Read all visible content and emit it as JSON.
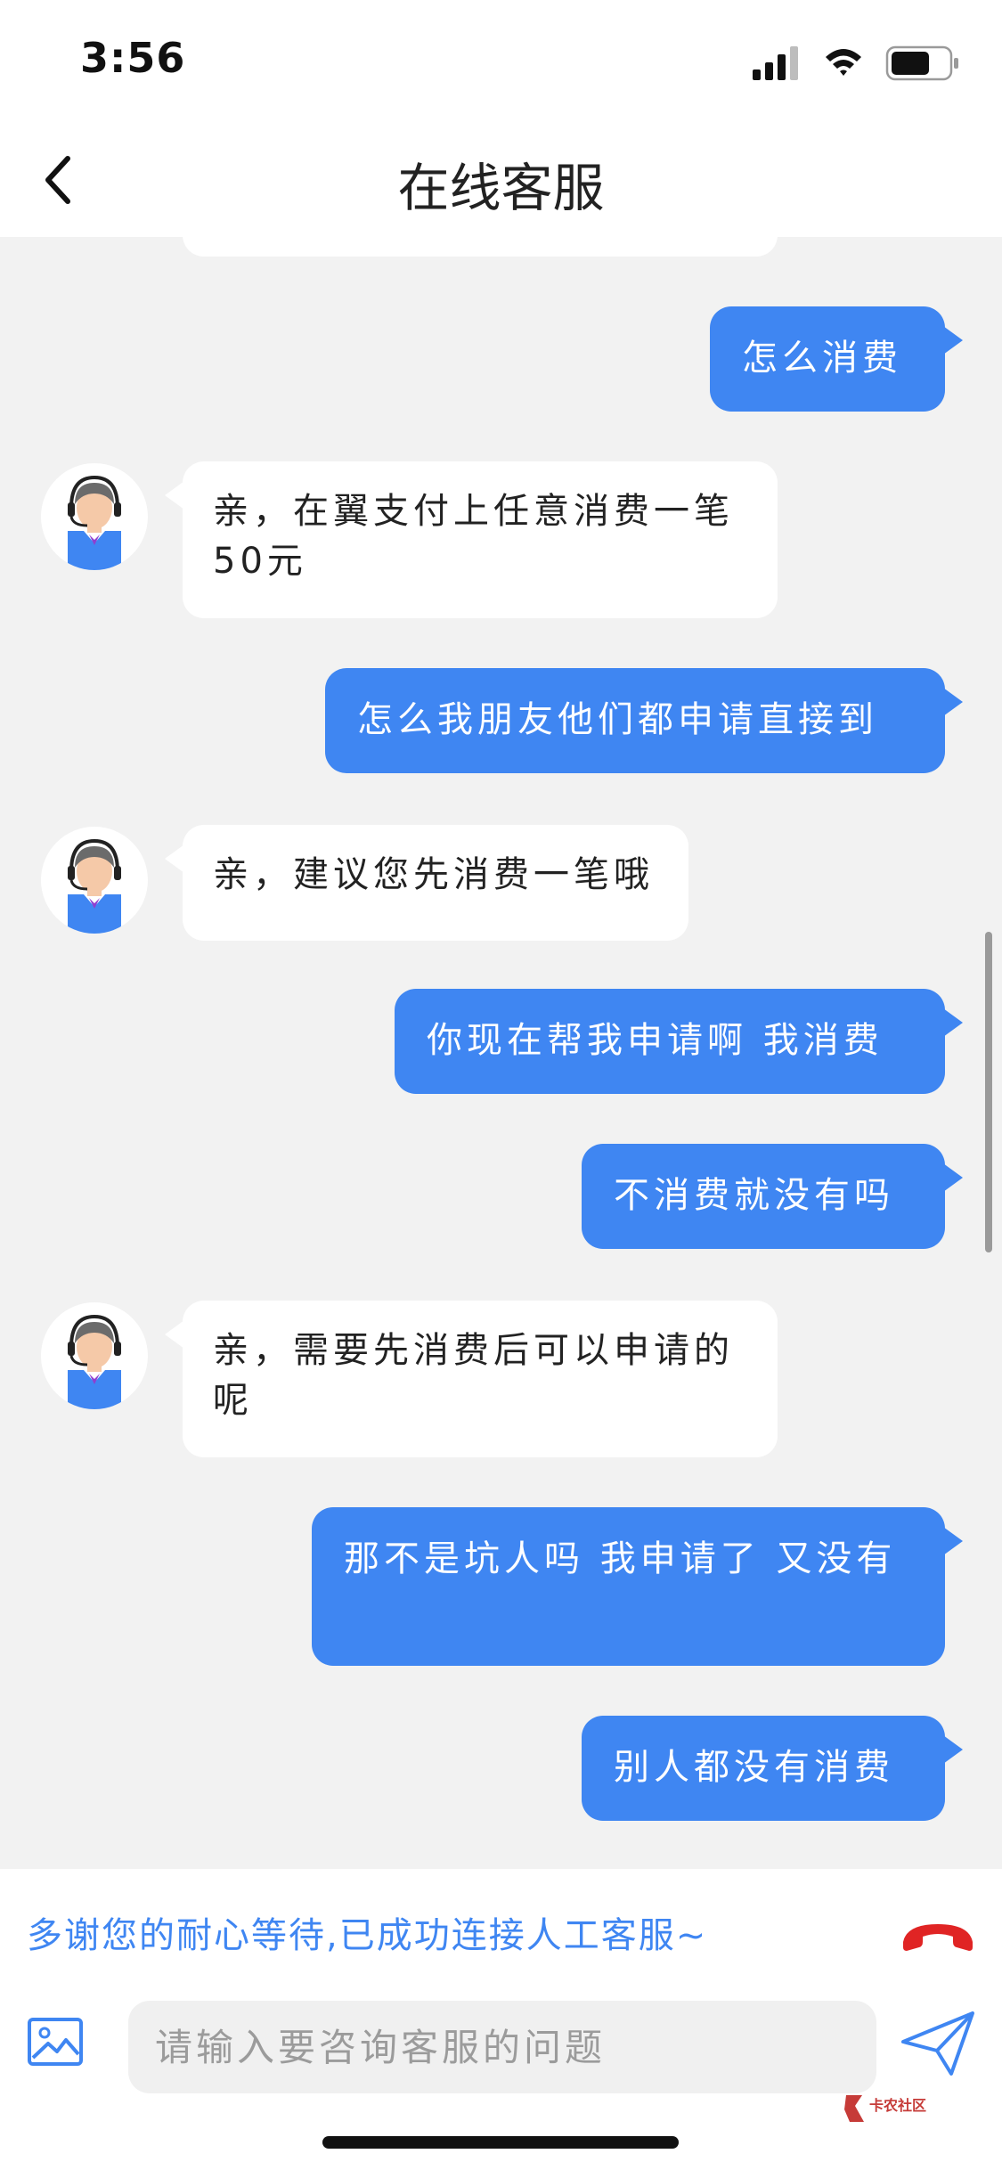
{
  "status_bar": {
    "time": "3:56"
  },
  "nav": {
    "title": "在线客服"
  },
  "colors": {
    "accent": "#3f86f2",
    "hangup": "#e02424",
    "background": "#f2f2f2"
  },
  "messages": [
    {
      "from": "user",
      "text": "怎么消费"
    },
    {
      "from": "agent",
      "text": "亲，在翼支付上任意消费一笔50元"
    },
    {
      "from": "user",
      "text": "怎么我朋友他们都申请直接到"
    },
    {
      "from": "agent",
      "text": "亲，建议您先消费一笔哦"
    },
    {
      "from": "user",
      "text": "你现在帮我申请啊 我消费"
    },
    {
      "from": "user",
      "text": "不消费就没有吗"
    },
    {
      "from": "agent",
      "text": "亲，需要先消费后可以申请的呢"
    },
    {
      "from": "user",
      "text": "那不是坑人吗 我申请了 又没有"
    },
    {
      "from": "user",
      "text": "别人都没有消费"
    }
  ],
  "notice": {
    "text": "多谢您的耐心等待,已成功连接人工客服~"
  },
  "input": {
    "placeholder": "请输入要咨询客服的问题",
    "value": ""
  },
  "icons": {
    "back": "chevron-left-icon",
    "hangup": "phone-hangup-icon",
    "image": "image-icon",
    "send": "send-icon",
    "avatar": "customer-service-agent-avatar"
  },
  "watermark": {
    "text": "卡农社区"
  }
}
